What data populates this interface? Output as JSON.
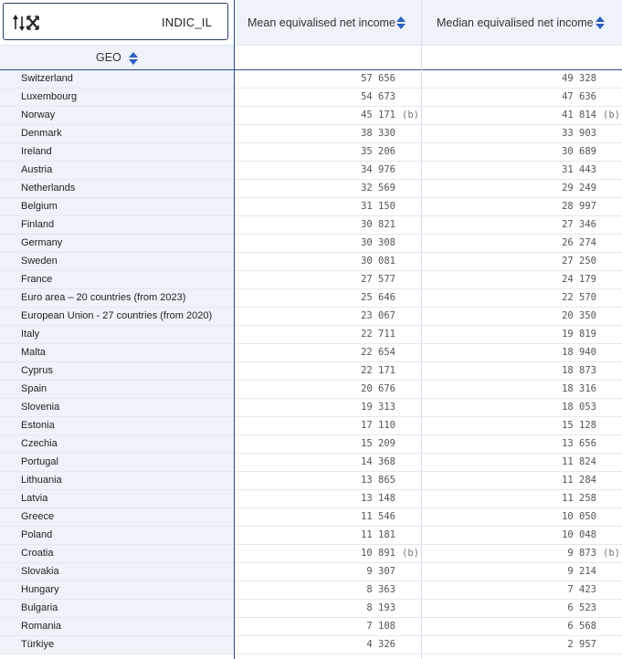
{
  "header": {
    "dimension_label": "INDIC_IL",
    "row_dimension_label": "GEO",
    "columns": [
      {
        "label": "Mean equivalised net income"
      },
      {
        "label": "Median equivalised net income"
      }
    ]
  },
  "icons": {
    "corner": "sort-swap-icon",
    "sort": "sort-up-down-icon"
  },
  "colors": {
    "header_bg": "#eef2f9",
    "border_dark": "#2f4a89",
    "sort_arrow": "#2f5fbf"
  },
  "rows": [
    {
      "geo": "Switzerland",
      "mean": "57 656",
      "mean_flag": "",
      "median": "49 328",
      "median_flag": ""
    },
    {
      "geo": "Luxembourg",
      "mean": "54 673",
      "mean_flag": "",
      "median": "47 636",
      "median_flag": ""
    },
    {
      "geo": "Norway",
      "mean": "45 171",
      "mean_flag": "(b)",
      "median": "41 814",
      "median_flag": "(b)"
    },
    {
      "geo": "Denmark",
      "mean": "38 330",
      "mean_flag": "",
      "median": "33 903",
      "median_flag": ""
    },
    {
      "geo": "Ireland",
      "mean": "35 206",
      "mean_flag": "",
      "median": "30 689",
      "median_flag": ""
    },
    {
      "geo": "Austria",
      "mean": "34 976",
      "mean_flag": "",
      "median": "31 443",
      "median_flag": ""
    },
    {
      "geo": "Netherlands",
      "mean": "32 569",
      "mean_flag": "",
      "median": "29 249",
      "median_flag": ""
    },
    {
      "geo": "Belgium",
      "mean": "31 150",
      "mean_flag": "",
      "median": "28 997",
      "median_flag": ""
    },
    {
      "geo": "Finland",
      "mean": "30 821",
      "mean_flag": "",
      "median": "27 346",
      "median_flag": ""
    },
    {
      "geo": "Germany",
      "mean": "30 308",
      "mean_flag": "",
      "median": "26 274",
      "median_flag": ""
    },
    {
      "geo": "Sweden",
      "mean": "30 081",
      "mean_flag": "",
      "median": "27 250",
      "median_flag": ""
    },
    {
      "geo": "France",
      "mean": "27 577",
      "mean_flag": "",
      "median": "24 179",
      "median_flag": ""
    },
    {
      "geo": "Euro area – 20 countries (from 2023)",
      "mean": "25 646",
      "mean_flag": "",
      "median": "22 570",
      "median_flag": ""
    },
    {
      "geo": "European Union - 27 countries (from 2020)",
      "mean": "23 067",
      "mean_flag": "",
      "median": "20 350",
      "median_flag": ""
    },
    {
      "geo": "Italy",
      "mean": "22 711",
      "mean_flag": "",
      "median": "19 819",
      "median_flag": ""
    },
    {
      "geo": "Malta",
      "mean": "22 654",
      "mean_flag": "",
      "median": "18 940",
      "median_flag": ""
    },
    {
      "geo": "Cyprus",
      "mean": "22 171",
      "mean_flag": "",
      "median": "18 873",
      "median_flag": ""
    },
    {
      "geo": "Spain",
      "mean": "20 676",
      "mean_flag": "",
      "median": "18 316",
      "median_flag": ""
    },
    {
      "geo": "Slovenia",
      "mean": "19 313",
      "mean_flag": "",
      "median": "18 053",
      "median_flag": ""
    },
    {
      "geo": "Estonia",
      "mean": "17 110",
      "mean_flag": "",
      "median": "15 128",
      "median_flag": ""
    },
    {
      "geo": "Czechia",
      "mean": "15 209",
      "mean_flag": "",
      "median": "13 656",
      "median_flag": ""
    },
    {
      "geo": "Portugal",
      "mean": "14 368",
      "mean_flag": "",
      "median": "11 824",
      "median_flag": ""
    },
    {
      "geo": "Lithuania",
      "mean": "13 865",
      "mean_flag": "",
      "median": "11 284",
      "median_flag": ""
    },
    {
      "geo": "Latvia",
      "mean": "13 148",
      "mean_flag": "",
      "median": "11 258",
      "median_flag": ""
    },
    {
      "geo": "Greece",
      "mean": "11 546",
      "mean_flag": "",
      "median": "10 050",
      "median_flag": ""
    },
    {
      "geo": "Poland",
      "mean": "11 181",
      "mean_flag": "",
      "median": "10 048",
      "median_flag": ""
    },
    {
      "geo": "Croatia",
      "mean": "10 891",
      "mean_flag": "(b)",
      "median": "9 873",
      "median_flag": "(b)"
    },
    {
      "geo": "Slovakia",
      "mean": "9 307",
      "mean_flag": "",
      "median": "9 214",
      "median_flag": ""
    },
    {
      "geo": "Hungary",
      "mean": "8 363",
      "mean_flag": "",
      "median": "7 423",
      "median_flag": ""
    },
    {
      "geo": "Bulgaria",
      "mean": "8 193",
      "mean_flag": "",
      "median": "6 523",
      "median_flag": ""
    },
    {
      "geo": "Romania",
      "mean": "7 108",
      "mean_flag": "",
      "median": "6 568",
      "median_flag": ""
    },
    {
      "geo": "Türkiye",
      "mean": "4 326",
      "mean_flag": "",
      "median": "2 957",
      "median_flag": ""
    }
  ]
}
